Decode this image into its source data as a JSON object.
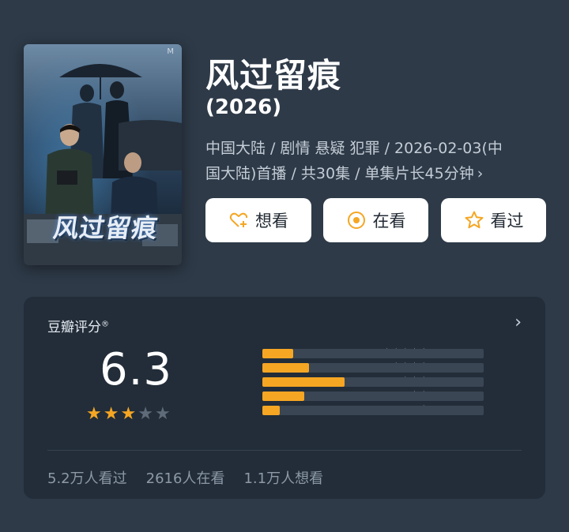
{
  "poster": {
    "title_art": "风过留痕",
    "corner_mark": "M"
  },
  "header": {
    "title": "风过留痕",
    "year": "(2026)",
    "meta_line1": "中国大陆 / 剧情 悬疑 犯罪 / 2026-02-03(中",
    "meta_line2": "国大陆)首播 / 共30集 / 单集片长45分钟",
    "meta_chevron": "›"
  },
  "actions": {
    "want_label": "想看",
    "watching_label": "在看",
    "watched_label": "看过"
  },
  "rating": {
    "heading": "豆瓣评分",
    "registered_mark": "®",
    "chevron": "›",
    "score": "6.3",
    "stars": 3,
    "max_stars": 5,
    "distribution": [
      {
        "stars": 5,
        "label": "★★★★★",
        "fraction": 0.14
      },
      {
        "stars": 4,
        "label": "★★★★",
        "fraction": 0.21
      },
      {
        "stars": 3,
        "label": "★★★",
        "fraction": 0.37
      },
      {
        "stars": 2,
        "label": "★★",
        "fraction": 0.19
      },
      {
        "stars": 1,
        "label": "★",
        "fraction": 0.08
      }
    ]
  },
  "counts": {
    "watched": "5.2万人看过",
    "watching": "2616人在看",
    "want": "1.1万人想看"
  },
  "colors": {
    "background": "#2e3a48",
    "card": "#222d39",
    "accent": "#f5a623",
    "track": "#3a4654"
  },
  "icons": {
    "want": "heart-plus-icon",
    "watching": "target-circle-icon",
    "watched": "star-outline-icon"
  }
}
